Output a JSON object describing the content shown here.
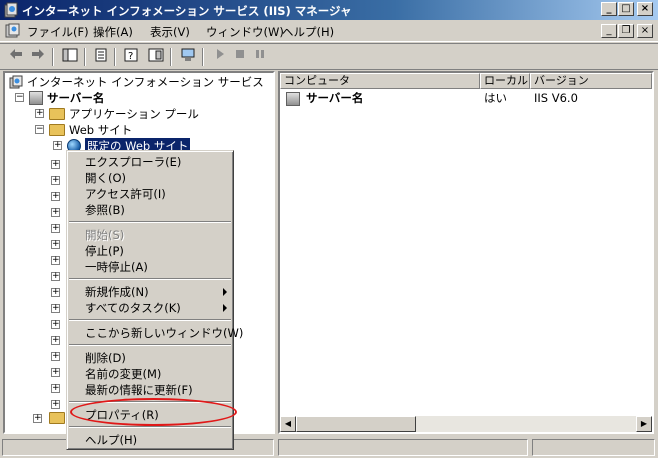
{
  "window": {
    "title": "インターネット インフォメーション サービス (IIS) マネージャ",
    "controls": {
      "minimize": "_",
      "maximize": "□",
      "close": "×"
    }
  },
  "menubar": {
    "items": [
      "ファイル(F)",
      "操作(A)",
      "表示(V)",
      "ウィンドウ(W)",
      "ヘルプ(H)"
    ],
    "mdi_controls": {
      "minimize": "_",
      "restore": "❐",
      "close": "×"
    }
  },
  "toolbar": {
    "buttons": [
      "back-icon",
      "forward-icon",
      "show-hide-tree-icon",
      "export-list-icon",
      "help-icon",
      "properties-icon",
      "computer-icon",
      "play-icon",
      "stop-icon",
      "pause-icon"
    ]
  },
  "tree": {
    "root": "インターネット インフォメーション サービス",
    "server": "サーバー名",
    "app_pools": "アプリケーション プール",
    "websites": "Web サイト",
    "default_site": "既定の Web サイト"
  },
  "list": {
    "columns": [
      "コンピュータ",
      "ローカル",
      "バージョン"
    ],
    "rows": [
      {
        "computer": "サーバー名",
        "local": "はい",
        "version": "IIS V6.0"
      }
    ]
  },
  "context_menu": {
    "items": [
      {
        "label": "エクスプローラ(E)",
        "disabled": false
      },
      {
        "label": "開く(O)",
        "disabled": false
      },
      {
        "label": "アクセス許可(I)",
        "disabled": false
      },
      {
        "label": "参照(B)",
        "disabled": false
      },
      {
        "label": "開始(S)",
        "disabled": true
      },
      {
        "label": "停止(P)",
        "disabled": false
      },
      {
        "label": "一時停止(A)",
        "disabled": false
      },
      {
        "label": "新規作成(N)",
        "disabled": false,
        "submenu": true
      },
      {
        "label": "すべてのタスク(K)",
        "disabled": false,
        "submenu": true
      },
      {
        "label": "ここから新しいウィンドウ(W)",
        "disabled": false
      },
      {
        "label": "削除(D)",
        "disabled": false
      },
      {
        "label": "名前の変更(M)",
        "disabled": false
      },
      {
        "label": "最新の情報に更新(F)",
        "disabled": false
      },
      {
        "label": "プロパティ(R)",
        "disabled": false,
        "highlighted": true
      },
      {
        "label": "ヘルプ(H)",
        "disabled": false
      }
    ]
  },
  "colors": {
    "title_gradient_start": "#0a246a",
    "selection": "#0a246a",
    "highlight_ellipse": "#e01818"
  }
}
